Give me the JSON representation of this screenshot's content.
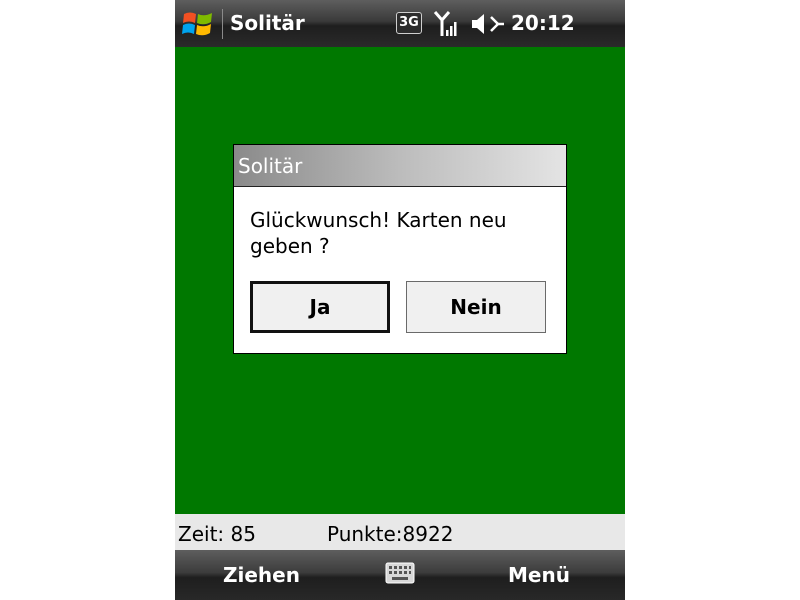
{
  "status_bar": {
    "app_title": "Solitär",
    "network": "3G",
    "time": "20:12",
    "icons": [
      "windows-start-icon",
      "signal-icon",
      "volume-icon"
    ]
  },
  "dialog": {
    "title": "Solitär",
    "message": "Glückwunsch! Karten neu geben ?",
    "yes_label": "Ja",
    "no_label": "Nein"
  },
  "score_bar": {
    "time_text": "Zeit: 85",
    "points_text": "Punkte:8922"
  },
  "soft_keys": {
    "left_label": "Ziehen",
    "right_label": "Menü",
    "center_icon": "keyboard-icon"
  },
  "colors": {
    "table_green": "#007800",
    "bar_dark": "#2a2a2a",
    "dialog_bg": "#ffffff",
    "score_bar_bg": "#e8e8e8"
  }
}
